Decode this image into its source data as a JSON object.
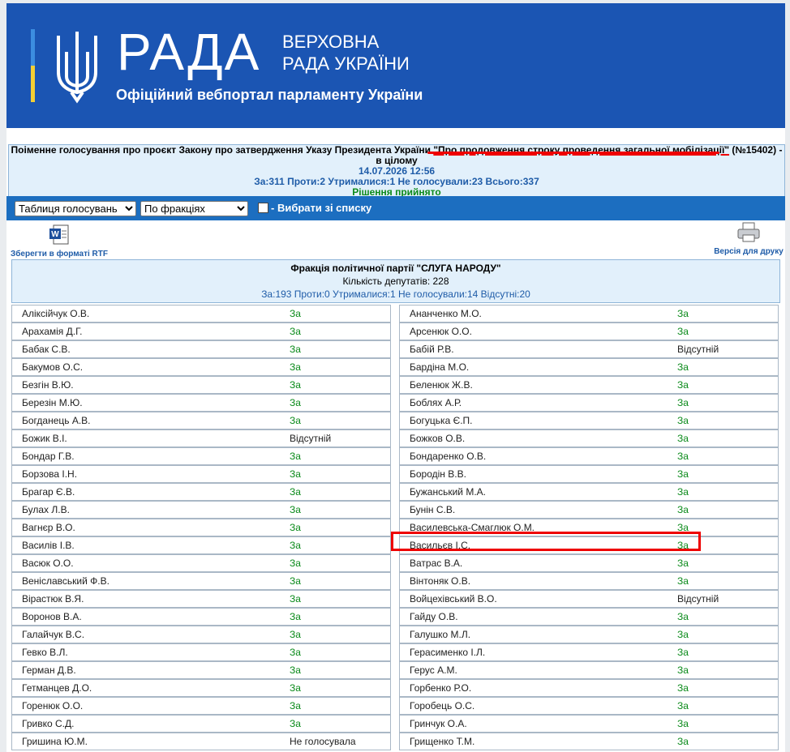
{
  "header": {
    "logo_big": "РАДА",
    "logo_small_1": "ВЕРХОВНА",
    "logo_small_2": "РАДА УКРАЇНИ",
    "subtitle": "Офіційний вебпортал парламенту України"
  },
  "vote": {
    "title_pre": "Поіменне голосування про проєкт Закону про затвердження Указу Президента України ",
    "title_hl": "\"Про продовження строку проведення загальної мобілізації\"",
    "title_post": " (№15402) -",
    "title_line2": "в цілому",
    "datetime": "14.07.2026 12:56",
    "summary": "За:311 Проти:2 Утрималися:1 Не голосували:23 Всього:337",
    "decision": "Рішення прийнято"
  },
  "toolbar": {
    "select1": "Таблиця голосувань",
    "select2": "По фракціях",
    "checkbox_label": "- Вибрати зі списку"
  },
  "tools": {
    "rtf_label": "Зберегти в форматі RTF",
    "print_label": "Версія для друку",
    "rtf_icon": "word-doc-icon",
    "print_icon": "printer-icon"
  },
  "faction": {
    "name": "Фракція політичної партії \"СЛУГА НАРОДУ\"",
    "count": "Кількість депутатів: 228",
    "summary": "За:193 Проти:0 Утрималися:1 Не голосували:14 Відсутні:20"
  },
  "colors": {
    "header": "#1b55b3",
    "toolbar": "#1c6ec0",
    "vote_for": "#0a8a1a",
    "highlight": "#e00000"
  },
  "left": [
    {
      "name": "Аліксійчук О.В.",
      "vote": "За"
    },
    {
      "name": "Арахамія Д.Г.",
      "vote": "За"
    },
    {
      "name": "Бабак С.В.",
      "vote": "За"
    },
    {
      "name": "Бакумов О.С.",
      "vote": "За"
    },
    {
      "name": "Безгін В.Ю.",
      "vote": "За"
    },
    {
      "name": "Березін М.Ю.",
      "vote": "За"
    },
    {
      "name": "Богданець А.В.",
      "vote": "За"
    },
    {
      "name": "Божик В.І.",
      "vote": "Відсутній"
    },
    {
      "name": "Бондар Г.В.",
      "vote": "За"
    },
    {
      "name": "Борзова І.Н.",
      "vote": "За"
    },
    {
      "name": "Брагар Є.В.",
      "vote": "За"
    },
    {
      "name": "Булах Л.В.",
      "vote": "За"
    },
    {
      "name": "Вагнєр В.О.",
      "vote": "За"
    },
    {
      "name": "Василів І.В.",
      "vote": "За"
    },
    {
      "name": "Васюк О.О.",
      "vote": "За"
    },
    {
      "name": "Веніславський Ф.В.",
      "vote": "За"
    },
    {
      "name": "Вірастюк В.Я.",
      "vote": "За"
    },
    {
      "name": "Воронов В.А.",
      "vote": "За"
    },
    {
      "name": "Галайчук В.С.",
      "vote": "За"
    },
    {
      "name": "Гевко В.Л.",
      "vote": "За"
    },
    {
      "name": "Герман Д.В.",
      "vote": "За"
    },
    {
      "name": "Гетманцев Д.О.",
      "vote": "За"
    },
    {
      "name": "Горенюк О.О.",
      "vote": "За"
    },
    {
      "name": "Гривко С.Д.",
      "vote": "За"
    },
    {
      "name": "Гришина Ю.М.",
      "vote": "Не голосувала"
    }
  ],
  "right": [
    {
      "name": "Ананченко М.О.",
      "vote": "За"
    },
    {
      "name": "Арсенюк О.О.",
      "vote": "За"
    },
    {
      "name": "Бабій Р.В.",
      "vote": "Відсутній"
    },
    {
      "name": "Бардіна М.О.",
      "vote": "За"
    },
    {
      "name": "Беленюк Ж.В.",
      "vote": "За"
    },
    {
      "name": "Боблях А.Р.",
      "vote": "За"
    },
    {
      "name": "Богуцька Є.П.",
      "vote": "За"
    },
    {
      "name": "Божков О.В.",
      "vote": "За"
    },
    {
      "name": "Бондаренко О.В.",
      "vote": "За"
    },
    {
      "name": "Бородін В.В.",
      "vote": "За"
    },
    {
      "name": "Бужанський М.А.",
      "vote": "За"
    },
    {
      "name": "Бунін С.В.",
      "vote": "За"
    },
    {
      "name": "Василевська-Смаглюк О.М.",
      "vote": "За"
    },
    {
      "name": "Васильєв І.С.",
      "vote": "За"
    },
    {
      "name": "Ватрас В.А.",
      "vote": "За"
    },
    {
      "name": "Вінтоняк О.В.",
      "vote": "За"
    },
    {
      "name": "Войцехівський В.О.",
      "vote": "Відсутній"
    },
    {
      "name": "Гайду О.В.",
      "vote": "За"
    },
    {
      "name": "Галушко М.Л.",
      "vote": "За"
    },
    {
      "name": "Герасименко І.Л.",
      "vote": "За"
    },
    {
      "name": "Герус А.М.",
      "vote": "За"
    },
    {
      "name": "Горбенко Р.О.",
      "vote": "За"
    },
    {
      "name": "Горобець О.С.",
      "vote": "За"
    },
    {
      "name": "Гринчук О.А.",
      "vote": "За"
    },
    {
      "name": "Грищенко Т.М.",
      "vote": "За"
    }
  ]
}
